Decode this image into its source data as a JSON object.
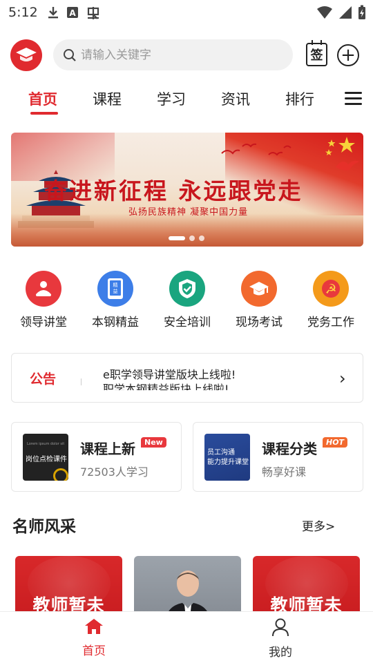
{
  "status_bar": {
    "time": "5:12",
    "icons": [
      "download-icon",
      "a-box-icon",
      "bug-icon",
      "wifi-icon",
      "signal-icon",
      "battery-charging-icon"
    ]
  },
  "header": {
    "search_placeholder": "请输入关键字",
    "sign_label": "签"
  },
  "tabs": [
    "首页",
    "课程",
    "学习",
    "资讯",
    "排行"
  ],
  "active_tab": 0,
  "banner": {
    "title": "奋进新征程 永远跟党走",
    "subtitle": "弘扬民族精神  凝聚中国力量",
    "slide_count": 3,
    "active_slide": 0
  },
  "quick_entries": [
    {
      "label": "领导讲堂",
      "color": "#e8383d",
      "icon": "leader-icon"
    },
    {
      "label": "本钢精益",
      "color": "#3d7ee8",
      "icon": "phone-book-icon",
      "glyph": "精益"
    },
    {
      "label": "安全培训",
      "color": "#1aa57f",
      "icon": "shield-icon"
    },
    {
      "label": "现场考试",
      "color": "#f2692e",
      "icon": "graduation-cap-icon"
    },
    {
      "label": "党务工作",
      "color": "#f49a1a",
      "icon": "party-emblem-icon",
      "glyph": "☭"
    }
  ],
  "notice": {
    "tag": "公告",
    "line1": "e职学领导讲堂版块上线啦!",
    "line2": "职学本钢精益版块上线啦!"
  },
  "cards": [
    {
      "title": "课程上新",
      "badge": "New",
      "badge_color": "#e8383d",
      "subtitle": "72503人学习",
      "thumb_text": "岗位点检课件",
      "thumb_top": "Lorem ipsum dolor sit amet"
    },
    {
      "title": "课程分类",
      "badge": "HOT",
      "badge_color": "#f2692e",
      "subtitle": "畅享好课",
      "thumb_text_1": "员工沟通",
      "thumb_text_2": "能力提升课堂"
    }
  ],
  "teachers_section": {
    "title": "名师风采",
    "more": "更多>",
    "items": [
      {
        "name": "教师暂未",
        "kind": "placeholder"
      },
      {
        "name": "",
        "kind": "photo"
      },
      {
        "name": "教师暂未",
        "kind": "placeholder"
      }
    ]
  },
  "bottom_nav": [
    {
      "label": "首页",
      "icon": "home-icon",
      "active": true
    },
    {
      "label": "我的",
      "icon": "user-icon",
      "active": false
    }
  ],
  "colors": {
    "accent": "#e02a2f",
    "text": "#222222",
    "muted": "#777777"
  }
}
